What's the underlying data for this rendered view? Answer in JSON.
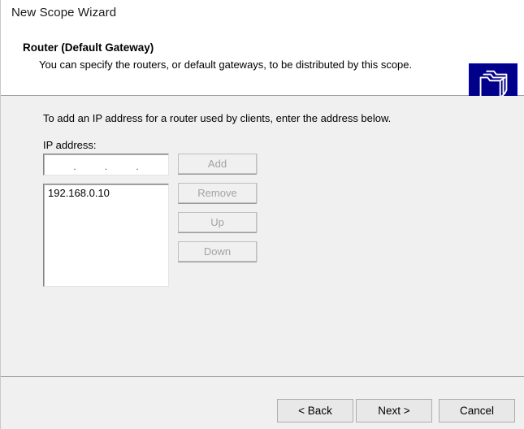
{
  "window": {
    "title": "New Scope Wizard"
  },
  "header": {
    "title": "Router (Default Gateway)",
    "subtitle": "You can specify the routers, or default gateways, to be distributed by this scope.",
    "icon": "folder-stack-icon",
    "icon_bg_color": "#00008b",
    "icon_line_color": "#ffffff"
  },
  "content": {
    "intro": "To add an IP address for a router used by clients, enter the address below.",
    "ip_field": {
      "label": "IP address:",
      "octets": [
        "",
        "",
        "",
        ""
      ],
      "separator": ".",
      "value": ""
    },
    "router_list": {
      "items": [
        "192.168.0.10"
      ]
    },
    "actions": [
      {
        "label": "Add",
        "enabled": false
      },
      {
        "label": "Remove",
        "enabled": false
      },
      {
        "label": "Up",
        "enabled": false
      },
      {
        "label": "Down",
        "enabled": false
      }
    ]
  },
  "footer": {
    "buttons": [
      {
        "label": "< Back",
        "enabled": true
      },
      {
        "label": "Next >",
        "enabled": true
      },
      {
        "label": "Cancel",
        "enabled": true
      }
    ]
  }
}
